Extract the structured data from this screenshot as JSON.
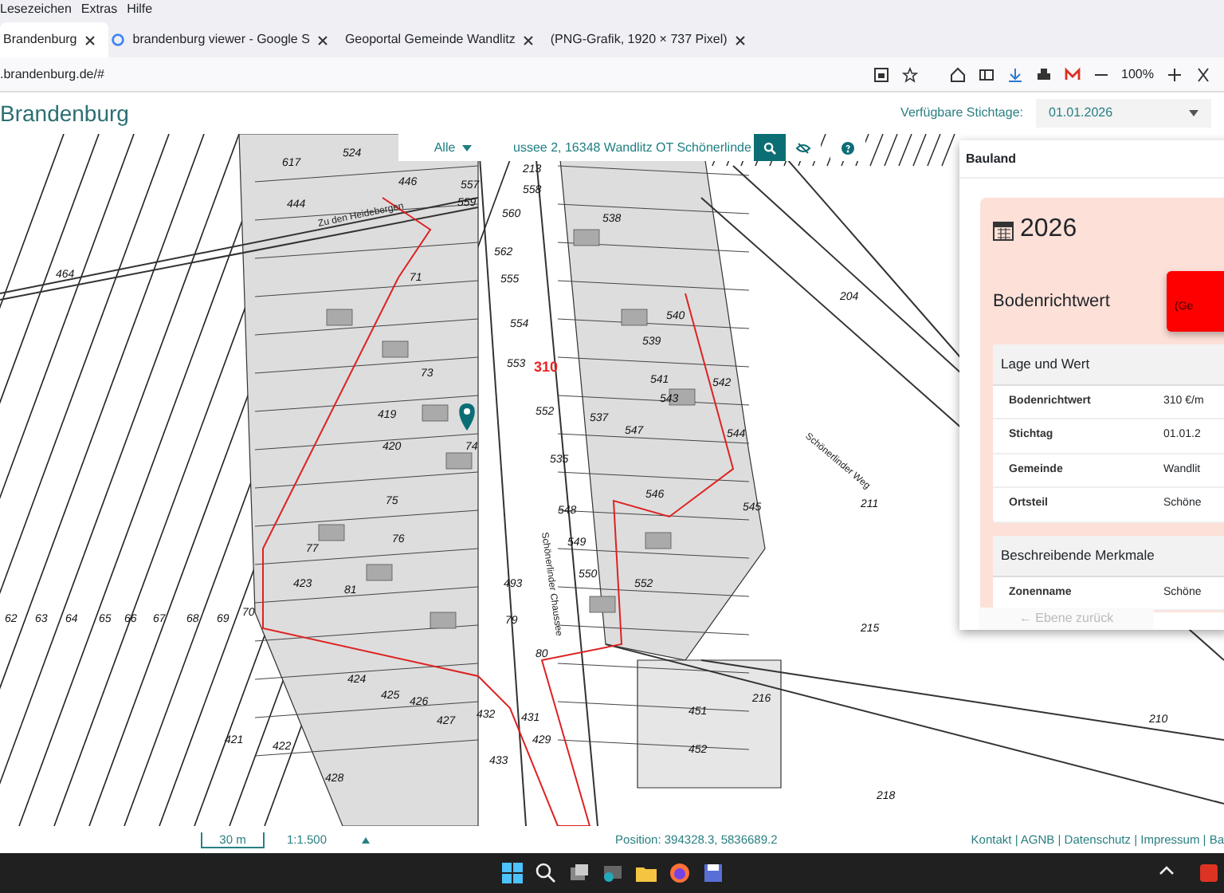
{
  "menu_bar": [
    "Lesezeichen",
    "Extras",
    "Hilfe"
  ],
  "tabs": [
    {
      "label": "Brandenburg",
      "selected": true,
      "favicon": false
    },
    {
      "label": "brandenburg viewer - Google S",
      "selected": false,
      "favicon": true
    },
    {
      "label": "Geoportal Gemeinde Wandlitz",
      "selected": false,
      "favicon": false
    },
    {
      "label": "(PNG-Grafik, 1920 × 737 Pixel)",
      "selected": false,
      "favicon": false
    }
  ],
  "address_bar": {
    "url": ".brandenburg.de/#",
    "zoom": "100%"
  },
  "app_header": {
    "title": "Brandenburg",
    "stichtage_label": "Verfügbare Stichtage:",
    "stichtag": "01.01.2026"
  },
  "search": {
    "filter": "Alle",
    "value": "ussee 2, 16348 Wandlitz OT Schönerlinde"
  },
  "map": {
    "parcel_labels": [
      "617",
      "524",
      "444",
      "446",
      "557",
      "559",
      "213",
      "558",
      "560",
      "538",
      "464",
      "562",
      "555",
      "554",
      "553",
      "539",
      "540",
      "204",
      "541",
      "542",
      "543",
      "547",
      "544",
      "537",
      "552",
      "535",
      "419",
      "74",
      "420",
      "73",
      "71",
      "75",
      "76",
      "548",
      "546",
      "545",
      "549",
      "211",
      "550",
      "423",
      "493",
      "77",
      "81",
      "79",
      "80",
      "215",
      "62",
      "63",
      "64",
      "65",
      "66",
      "67",
      "68",
      "69",
      "70",
      "424",
      "425",
      "426",
      "427",
      "432",
      "431",
      "429",
      "433",
      "451",
      "216",
      "452",
      "210",
      "421",
      "422",
      "428",
      "218",
      "552"
    ],
    "highlight_label": "310",
    "street_names": [
      "Schönerlinder Chaussee",
      "Zu den Heidebergen",
      "Schönerlinder Weg"
    ]
  },
  "panel": {
    "title": "Bauland",
    "year": "2026",
    "heading": "Bodenrichtwert",
    "badge": "(Ge",
    "sections": [
      {
        "title": "Lage und Wert",
        "rows": [
          {
            "label": "Bodenrichtwert",
            "value": "310 €/m"
          },
          {
            "label": "Stichtag",
            "value": "01.01.2"
          },
          {
            "label": "Gemeinde",
            "value": "Wandlit"
          },
          {
            "label": "Ortsteil",
            "value": "Schöne"
          }
        ]
      },
      {
        "title": "Beschreibende Merkmale",
        "rows": [
          {
            "label": "Zonenname",
            "value": "Schöne"
          }
        ]
      }
    ],
    "back_button": {
      "label": "← Ebene zurück",
      "disabled": true
    }
  },
  "footer": {
    "scale": "30 m",
    "ratio": "1:1.500",
    "position": "Position: 394328.3, 5836689.2",
    "links": "Kontakt | AGNB | Datenschutz | Impressum | Ba"
  }
}
